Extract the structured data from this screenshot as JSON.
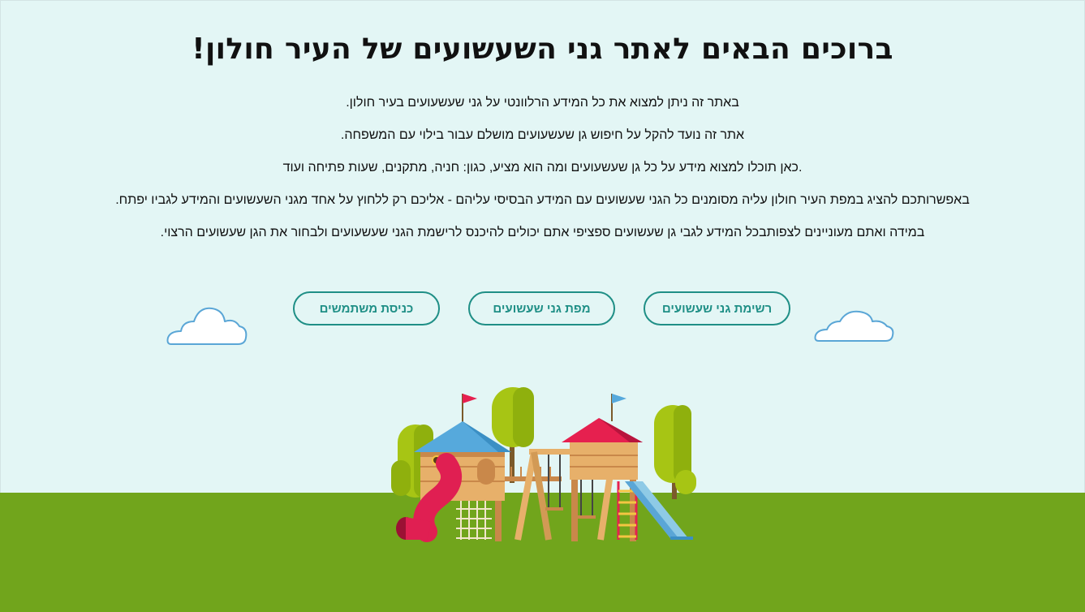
{
  "header": {
    "title": "ברוכים הבאים לאתר גני השעשועים של העיר חולון!"
  },
  "intro": {
    "lines": [
      "באתר זה ניתן למצוא את כל המידע הרלוונטי על גני שעשעועים בעיר חולון.",
      "אתר זה נועד להקל על חיפוש גן שעשעועים מושלם עבור בילוי עם המשפחה.",
      ".כאן תוכלו למצוא מידע על כל גן שעשעועים ומה הוא מציע, כגון: חניה, מתקנים, שעות פתיחה ועוד",
      "באפשרותכם להציג במפת העיר חולון עליה מסומנים כל הגני שעשועים עם המידע הבסיסי עליהם - אליכם רק ללחוץ על אחד מגני השעשועים והמידע לגביו יפתח.",
      "במידה ואתם מעוניינים לצפותבכל המידע לגבי גן שעשועים ספציפי אתם יכולים להיכנס לרישמת הגני שעשעועים ולבחור את הגן שעשועים הרצוי."
    ]
  },
  "nav": {
    "list_label": "רשימת גני שעשועים",
    "map_label": "מפת גני שעשועים",
    "login_label": "כניסת משתמשים"
  },
  "colors": {
    "background": "#e3f6f5",
    "accent": "#1f8f86",
    "ground": "#71a51c"
  },
  "icons": {
    "cloud_left": "cloud-icon",
    "cloud_right": "cloud-icon",
    "illustration": "playground-illustration"
  }
}
